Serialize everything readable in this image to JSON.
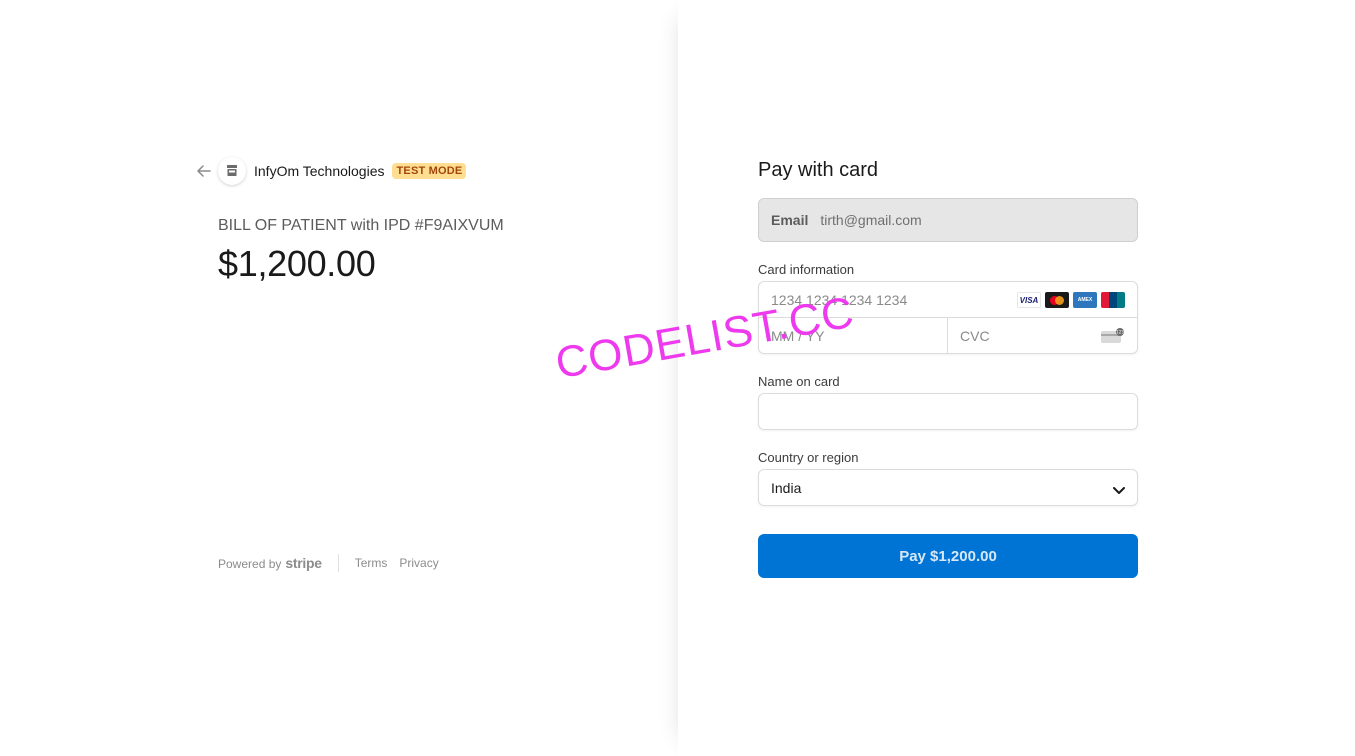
{
  "merchant": {
    "name": "InfyOm Technologies",
    "badge": "TEST MODE"
  },
  "product": {
    "name": "BILL OF PATIENT with IPD #F9AIXVUM",
    "amount": "$1,200.00"
  },
  "footer": {
    "powered_by": "Powered by",
    "stripe": "stripe",
    "terms": "Terms",
    "privacy": "Privacy"
  },
  "form": {
    "title": "Pay with card",
    "email_label": "Email",
    "email_value": "tirth@gmail.com",
    "card_label": "Card information",
    "card_number_placeholder": "1234 1234 1234 1234",
    "expiry_placeholder": "MM / YY",
    "cvc_placeholder": "CVC",
    "card_brands": [
      "VISA",
      "Mastercard",
      "AMEX",
      "UnionPay"
    ],
    "name_label": "Name on card",
    "name_value": "",
    "country_label": "Country or region",
    "country_value": "India",
    "pay_label": "Pay $1,200.00"
  },
  "watermark": "CODELIST.CC",
  "colors": {
    "accent": "#0074d4",
    "badge_bg": "#ffde92",
    "badge_text": "#a3470b",
    "watermark": "#ee3aee"
  },
  "icons": {
    "back": "arrow-left-icon",
    "store": "store-icon",
    "chevron": "chevron-down-icon",
    "cvc": "cvc-card-icon"
  }
}
